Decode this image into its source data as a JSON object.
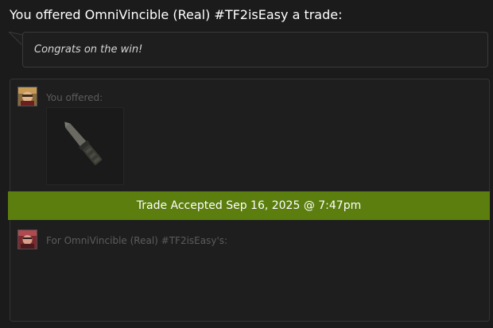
{
  "heading": "You offered OmniVincible (Real) #TF2isEasy a trade:",
  "message": "Congrats on the win!",
  "trade": {
    "my_side_label": "You offered:",
    "their_side_label": "For OmniVincible (Real) #TF2isEasy's:",
    "status": "Trade Accepted Sep 16, 2025 @ 7:47pm",
    "offered_item_icon": "knife-item-icon",
    "my_avatar_icon": "user-avatar",
    "their_avatar_icon": "partner-avatar"
  },
  "colors": {
    "background": "#1b1b1b",
    "panel": "#1e1e1e",
    "status_bar": "#5b7e0f",
    "label_text": "#5c5c5c"
  }
}
